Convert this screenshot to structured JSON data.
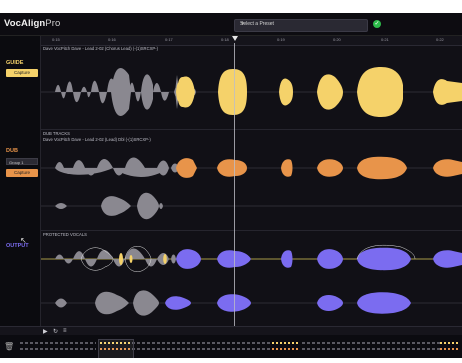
{
  "app": {
    "title": "VocAlign",
    "title_suffix": "Pro"
  },
  "preset": {
    "label": "Select a Preset",
    "chevron_icon": "chevron-down-icon"
  },
  "status": {
    "icon": "check-circle-icon",
    "color": "#2dbb4a"
  },
  "ruler": {
    "ticks": [
      "0:15",
      "0:16",
      "0:17",
      "0:18",
      "0:19",
      "0:20",
      "0:21",
      "0:22"
    ]
  },
  "guide": {
    "section_label": "GUIDE",
    "button_label": "Capture",
    "track_title": "Dave VocPitch Dave - Lead 2-02 (Chorus Lead) (-(1)SRCXP-)",
    "color": "#f5d26a"
  },
  "dub": {
    "section_label": "DUB",
    "group_select": "Group 1",
    "button_label": "Capture",
    "track_title_top": "DUB TRACKS",
    "track_title": "Dave VocPitch Dave - Lead 2-02 (Lead) Dbl (-(1)SRCXP-)",
    "color": "#e8944a"
  },
  "output": {
    "section_label": "OUTPUT",
    "track_title": "PROTECTED VOCALS",
    "color": "#7b6cf0"
  },
  "colors": {
    "guide": "#f5d26a",
    "dub": "#e8944a",
    "output": "#7b6cf0",
    "gray_wave": "#8a8890"
  }
}
